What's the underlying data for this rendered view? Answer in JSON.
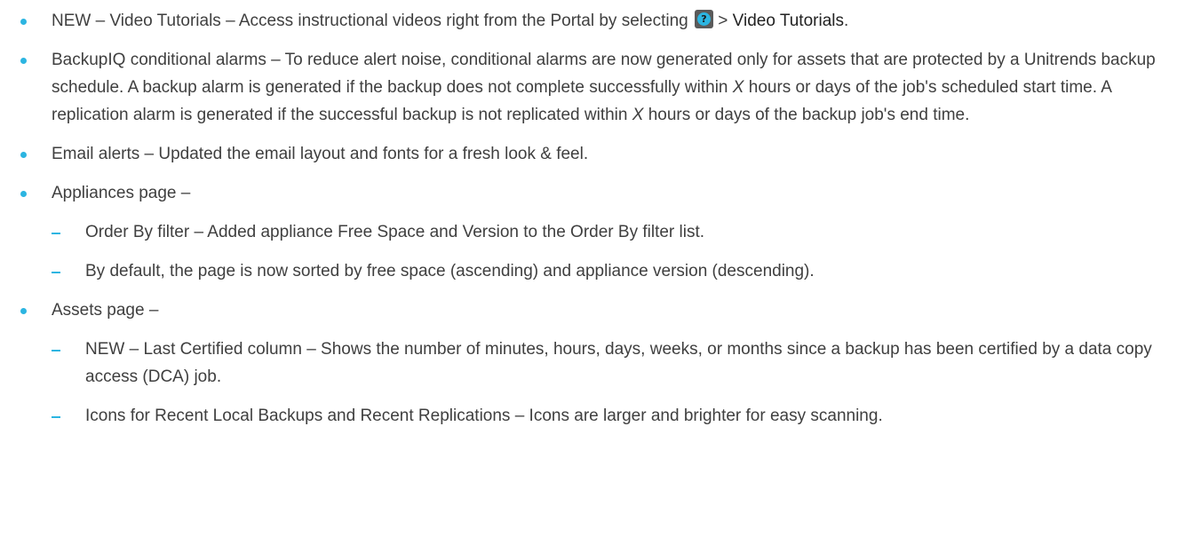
{
  "bullets": [
    {
      "text_before": "NEW – Video Tutorials – Access instructional videos right from the Portal by selecting ",
      "icon": "help-icon",
      "icon_glyph": "?",
      "text_between": " > ",
      "menu_item": "Video Tutorials",
      "text_after": "."
    },
    {
      "part1": "BackupIQ conditional alarms – To reduce alert noise, conditional alarms are now generated only for assets that are protected by a Unitrends backup schedule. A backup alarm is generated if the backup does not complete successfully within ",
      "var1": "X",
      "part2": " hours or days of the job's scheduled start time. A replication alarm is generated if the successful backup is not replicated within ",
      "var2": "X",
      "part3": " hours or days of the backup job's end time."
    },
    {
      "text": "Email alerts – Updated the email layout and fonts for a fresh look & feel."
    },
    {
      "text": "Appliances page –",
      "subitems": [
        "Order By filter – Added appliance Free Space and Version to the Order By filter list.",
        "By default, the page is now sorted by free space (ascending) and appliance version (descending)."
      ]
    },
    {
      "text": "Assets page –",
      "subitems": [
        "NEW – Last Certified column – Shows the number of minutes, hours, days, weeks, or months since a backup has been certified by a data copy access (DCA) job.",
        "Icons for Recent Local Backups and Recent Replications – Icons are larger and brighter for easy scanning."
      ]
    }
  ],
  "colors": {
    "bullet": "#2cb5e1",
    "text": "#3f3f3f",
    "icon_bg": "#5a5a5a"
  }
}
